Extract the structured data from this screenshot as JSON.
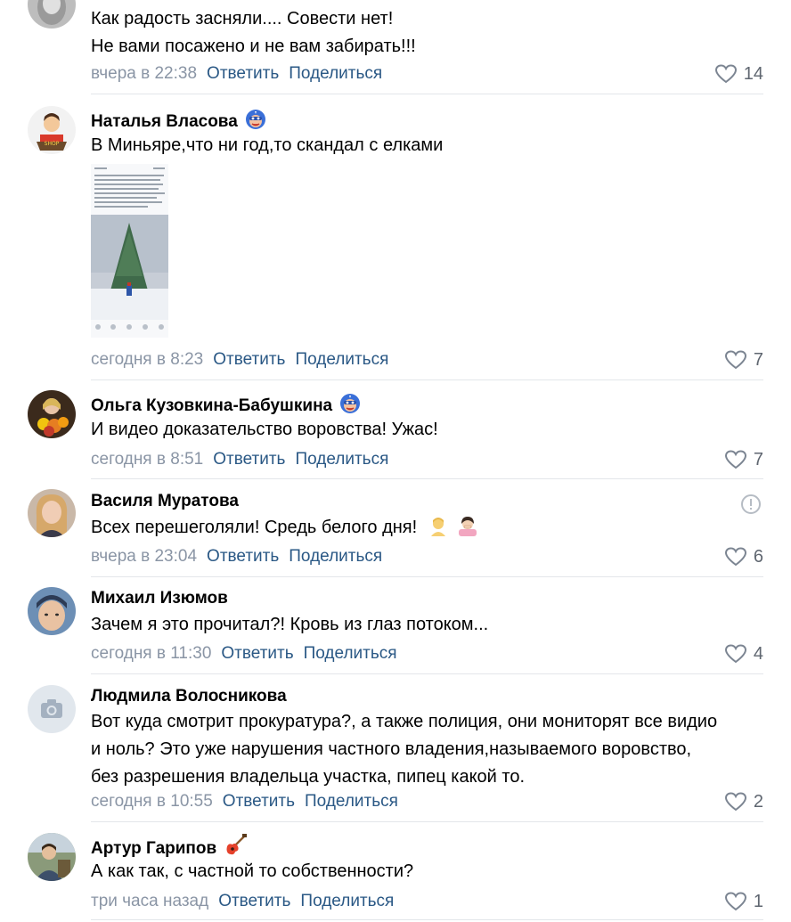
{
  "comments": [
    {
      "author": "",
      "text_lines": [
        "Как радость засняли.... Совести нет!",
        "Не вами посажено и не вам забирать!!!"
      ],
      "time": "вчера в 22:38",
      "reply": "Ответить",
      "share": "Поделиться",
      "likes": "14"
    },
    {
      "author": "Наталья Власова",
      "text_lines": [
        "В Миньяре,что ни год,то скандал с елками"
      ],
      "time": "сегодня в 8:23",
      "reply": "Ответить",
      "share": "Поделиться",
      "likes": "7"
    },
    {
      "author": "Ольга Кузовкина-Бабушкина",
      "text_lines": [
        "И видео доказательство воровства! Ужас!"
      ],
      "time": "сегодня в 8:51",
      "reply": "Ответить",
      "share": "Поделиться",
      "likes": "7"
    },
    {
      "author": "Василя Муратова",
      "text_lines": [
        "Всех перешеголяли! Средь белого дня!"
      ],
      "time": "вчера в 23:04",
      "reply": "Ответить",
      "share": "Поделиться",
      "likes": "6"
    },
    {
      "author": "Михаил Изюмов",
      "text_lines": [
        "Зачем я это прочитал?! Кровь из глаз потоком..."
      ],
      "time": "сегодня в 11:30",
      "reply": "Ответить",
      "share": "Поделиться",
      "likes": "4"
    },
    {
      "author": "Людмила Волосникова",
      "text_lines": [
        "Вот куда смотрит прокуратура?, а также полиция, они мониторят все видио",
        "и ноль? Это уже нарушения частного владения,называемого воровство,",
        "без разрешения владельца участка, пипец какой то."
      ],
      "time": "сегодня в 10:55",
      "reply": "Ответить",
      "share": "Поделиться",
      "likes": "2"
    },
    {
      "author": "Артур Гарипов",
      "text_lines": [
        "А как так, с частной то собственности?"
      ],
      "time": "три часа назад",
      "reply": "Ответить",
      "share": "Поделиться",
      "likes": "1"
    }
  ],
  "icons": {
    "like": "heart-icon",
    "report": "exclamation-circle-icon",
    "badge": "superhero-badge-icon",
    "author_badge_guitar": "guitar-icon",
    "emoji_1": "person-blond-emoji",
    "emoji_2": "person-facepalm-emoji",
    "placeholder_avatar": "camera-icon"
  },
  "colors": {
    "link": "#2a5885",
    "meta": "#8a95a5",
    "separator": "#e3e6ea",
    "like_count": "#5f6670"
  }
}
